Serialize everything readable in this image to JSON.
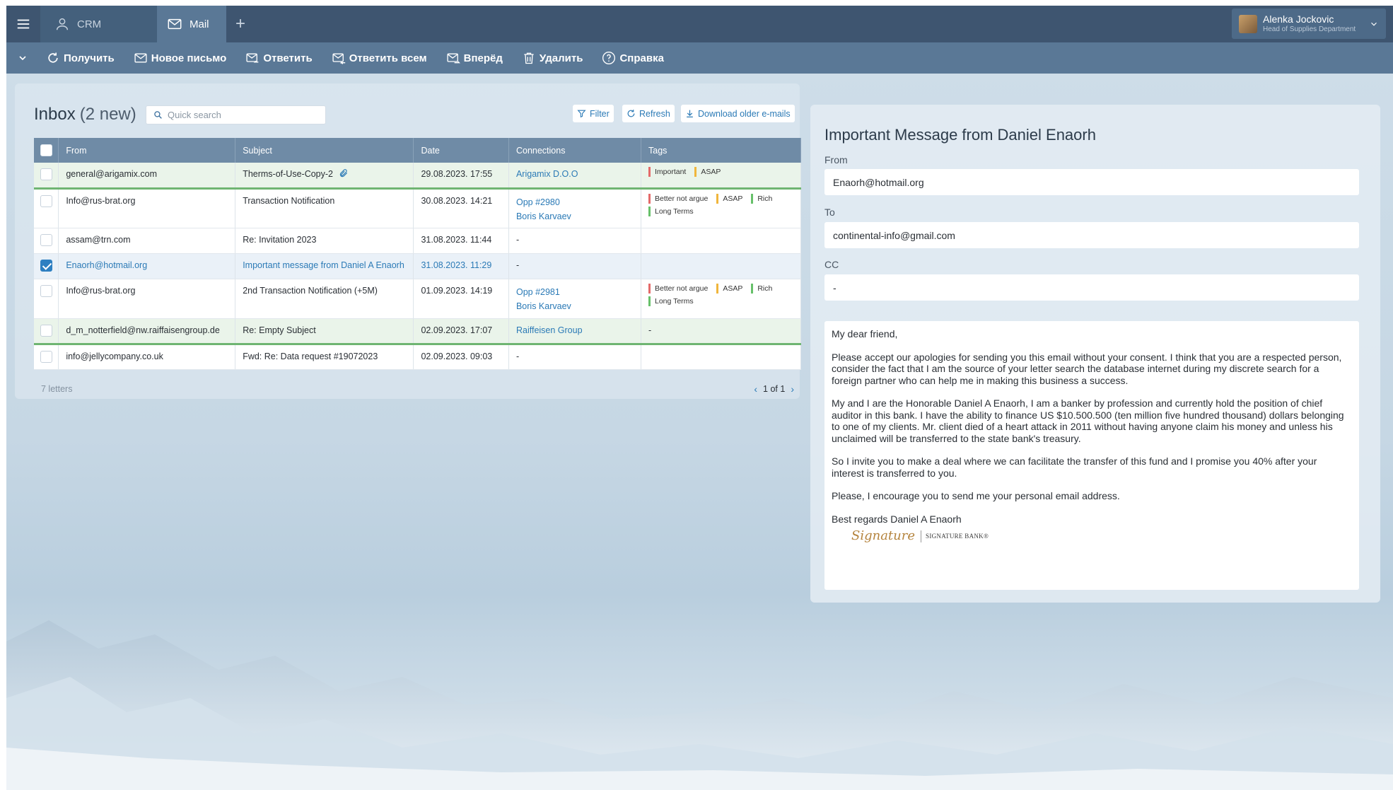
{
  "topbar": {
    "tabs": [
      {
        "label": "CRM",
        "icon": "user-icon"
      },
      {
        "label": "Mail",
        "icon": "envelope-icon"
      }
    ],
    "user": {
      "name": "Alenka Jockovic",
      "role": "Head of Supplies Department"
    }
  },
  "toolbar": {
    "receive": "Получить",
    "new_mail": "Новое письмо",
    "reply": "Ответить",
    "reply_all": "Ответить всем",
    "forward": "Вперёд",
    "delete": "Удалить",
    "help": "Справка"
  },
  "inbox": {
    "title": "Inbox",
    "new_count": "(2 new)",
    "search_placeholder": "Quick search",
    "filter": "Filter",
    "refresh": "Refresh",
    "download": "Download older e-mails",
    "columns": [
      "From",
      "Subject",
      "Date",
      "Connections",
      "Tags"
    ],
    "rows": [
      {
        "from": "general@arigamix.com",
        "subject": "Therms-of-Use-Copy-2",
        "date": "29.08.2023. 17:55",
        "connections": [
          "Arigamix D.O.O"
        ],
        "tags": [
          {
            "label": "Important",
            "color": "red"
          },
          {
            "label": "ASAP",
            "color": "yellow"
          }
        ]
      },
      {
        "from": "Info@rus-brat.org",
        "subject": "Transaction Notification",
        "date": "30.08.2023. 14:21",
        "connections": [
          "Opp #2980",
          "Boris Karvaev"
        ],
        "tags": [
          {
            "label": "Better not argue",
            "color": "red"
          },
          {
            "label": "ASAP",
            "color": "yellow"
          },
          {
            "label": "Rich",
            "color": "green"
          },
          {
            "label": "Long Terms",
            "color": "green"
          }
        ]
      },
      {
        "from": "assam@trn.com",
        "subject": "Re: Invitation 2023",
        "date": "31.08.2023. 11:44",
        "connections": [
          "-"
        ],
        "tags": []
      },
      {
        "from": "Enaorh@hotmail.org",
        "subject": "Important message from Daniel A Enaorh",
        "date": "31.08.2023. 11:29",
        "connections": [
          "-"
        ],
        "tags": []
      },
      {
        "from": "Info@rus-brat.org",
        "subject": "2nd Transaction Notification (+5M)",
        "date": "01.09.2023. 14:19",
        "connections": [
          "Opp #2981",
          "Boris Karvaev"
        ],
        "tags": [
          {
            "label": "Better not argue",
            "color": "red"
          },
          {
            "label": "ASAP",
            "color": "yellow"
          },
          {
            "label": "Rich",
            "color": "green"
          },
          {
            "label": "Long Terms",
            "color": "green"
          }
        ]
      },
      {
        "from": "d_m_notterfield@nw.raiffaisengroup.de",
        "subject": "Re: Empty Subject",
        "date": "02.09.2023. 17:07",
        "connections": [
          "Raiffeisen Group"
        ],
        "tags_text": "-"
      },
      {
        "from": "info@jellycompany.co.uk",
        "subject": "Fwd: Re: Data request #19072023",
        "date": "02.09.2023. 09:03",
        "connections": [
          "-"
        ],
        "tags": []
      }
    ],
    "count_label": "7 letters",
    "pager": "1 of 1"
  },
  "preview": {
    "title": "Important Message from Daniel Enaorh",
    "from_label": "From",
    "from": "Enaorh@hotmail.org",
    "to_label": "To",
    "to": "continental-info@gmail.com",
    "cc_label": "CC",
    "cc": "-",
    "body": [
      "My dear friend,",
      "Please accept our apologies for sending you this email without your consent. I think that you are a respected person, consider the fact that I am the source of your letter search the database internet during my discrete search for a foreign partner who can help me in making this business a success.",
      "My and I are the Honorable Daniel A Enaorh, I am a banker by profession and currently hold the position of chief auditor in this bank. I have the ability to finance US $10.500.500 (ten million five hundred thousand) dollars belonging to one of my clients. Mr. client died of a heart attack in 2011 without having anyone claim his money and unless his unclaimed will be transferred to the state bank's treasury.",
      "So I invite you to make a deal where we can facilitate the transfer of this fund and I promise you 40% after your interest is transferred to you.",
      "Please, I encourage you to send me your personal email address.",
      "Best regards Daniel A Enaorh"
    ],
    "signature_bank": "SIGNATURE BANK®",
    "signature_script": "Signature"
  },
  "colors": {
    "topbar": "#3e5570",
    "toolbar": "#5a7896",
    "accent": "#2b7ab6",
    "header": "#6f8ba6"
  }
}
